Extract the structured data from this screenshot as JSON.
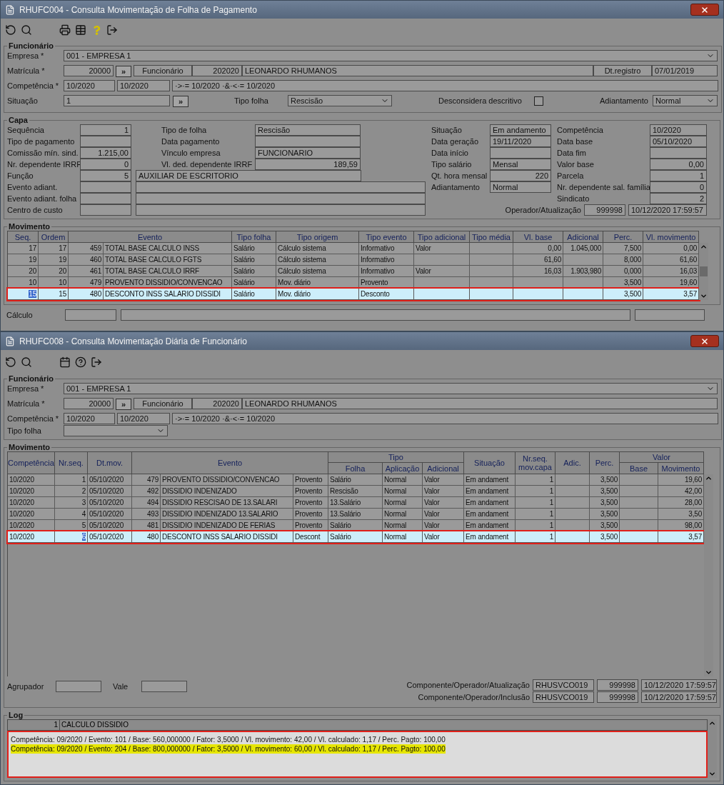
{
  "payroll_window": {
    "title": "RHUFC004 - Consulta Movimentação de Folha de Pagamento",
    "employee": {
      "legend": "Funcionário",
      "empresa": {
        "label": "Empresa *",
        "value": "001 - EMPRESA 1"
      },
      "matricula": {
        "label": "Matrícula *",
        "value": "20000",
        "button": "»"
      },
      "funcionario": {
        "label": "Funcionário",
        "code": "202020",
        "name": "LEONARDO RHUMANOS"
      },
      "registro": {
        "label": "Dt.registro",
        "value": "07/01/2019"
      },
      "competencia": {
        "label": "Competência *",
        "from": "10/2020",
        "to": "10/2020",
        "expression": "·>·= 10/2020 ·&·<·= 10/2020"
      },
      "situacao": {
        "label": "Situação",
        "value": "1",
        "button": "»"
      },
      "tipo_folha": {
        "label": "Tipo folha",
        "value": "Rescisão"
      },
      "desconsidera": {
        "label": "Desconsidera descritivo",
        "checked": false
      },
      "adiantamento": {
        "label": "Adiantamento",
        "value": "Normal"
      }
    },
    "capa": {
      "legend": "Capa",
      "left_rows": [
        [
          {
            "kind": "field",
            "label": "Sequência",
            "value": "1",
            "numeric": true
          },
          {
            "kind": "field",
            "label": "Tipo de folha",
            "value": "Rescisão",
            "numeric": false
          }
        ],
        [
          {
            "kind": "field",
            "label": "Tipo de pagamento"
          },
          {
            "kind": "field",
            "label": "Data pagamento"
          }
        ],
        [
          {
            "kind": "field",
            "label": "Comissão mín. sind.",
            "value": "1.215,00",
            "numeric": true
          },
          {
            "kind": "field",
            "label": "Vínculo empresa",
            "value": "FUNCIONARIO",
            "numeric": false
          }
        ],
        [
          {
            "kind": "field",
            "label": "Nr. dependente IRRF",
            "value": "0",
            "numeric": true
          },
          {
            "kind": "field",
            "label": "Vl. ded. dependente IRRF",
            "value": "189,59",
            "numeric": true
          }
        ],
        [
          {
            "kind": "field",
            "label": "Função",
            "value": "5",
            "numeric": true
          },
          {
            "kind": "box",
            "value": "AUXILIAR DE ESCRITORIO",
            "numeric": false
          }
        ],
        [
          {
            "kind": "field",
            "label": "Evento adiant."
          },
          {
            "kind": "long_box"
          }
        ],
        [
          {
            "kind": "field",
            "label": "Evento adiant. folha"
          },
          {
            "kind": "long_box"
          }
        ],
        [
          {
            "kind": "field",
            "label": "Centro de custo"
          },
          {
            "kind": "long_box"
          }
        ]
      ],
      "right_columns": [
        [
          {
            "label": "Situação",
            "value": "Em andamento",
            "numeric": false
          },
          {
            "label": "Data geração",
            "value": "19/11/2020",
            "numeric": false
          },
          {
            "label": "Data início"
          },
          {
            "label": "Tipo salário",
            "value": "Mensal",
            "numeric": false
          },
          {
            "label": "Qt. hora mensal",
            "value": "220",
            "numeric": true
          },
          {
            "label": "Adiantamento",
            "value": "Normal",
            "numeric": false
          }
        ],
        [
          {
            "label": "Competência",
            "value": "10/2020",
            "numeric": false
          },
          {
            "label": "Data base",
            "value": "05/10/2020",
            "numeric": false
          },
          {
            "label": "Data fim"
          },
          {
            "label": "Valor base",
            "value": "0,00",
            "numeric": true
          },
          {
            "label": "Parcela",
            "value": "1",
            "numeric": true
          },
          {
            "label": "Nr. dependente sal. família",
            "value": "0",
            "numeric": true
          },
          {
            "label": "Sindicato",
            "value": "2",
            "numeric": true
          }
        ]
      ],
      "operator": {
        "label": "Operador/Atualização",
        "code": "999998",
        "timestamp": "10/12/2020 17:59:57"
      }
    },
    "movimento": {
      "legend": "Movimento",
      "columns": [
        {
          "label": "Seq."
        },
        {
          "label": "Ordem"
        },
        {
          "label": "Evento"
        },
        {
          "label": "Tipo folha"
        },
        {
          "label": "Tipo origem"
        },
        {
          "label": "Tipo evento"
        },
        {
          "label": "Tipo adicional"
        },
        {
          "label": "Tipo média"
        },
        {
          "label": "Vl. base"
        },
        {
          "label": "Adicional"
        },
        {
          "label": "Perc."
        },
        {
          "label": "Vl. movimento"
        }
      ],
      "rows": [
        {
          "selected": false,
          "outlined": false,
          "cells": [
            "17",
            "17",
            {
              "code": "459",
              "name": "TOTAL BASE CALCULO INSS"
            },
            "Salário",
            "Cálculo sistema",
            "Informativo",
            "Valor",
            null,
            "0,00",
            "1.045,000",
            "7,500",
            "0,00"
          ]
        },
        {
          "selected": false,
          "outlined": false,
          "cells": [
            "19",
            "19",
            {
              "code": "460",
              "name": "TOTAL BASE CALCULO FGTS"
            },
            "Salário",
            "Cálculo sistema",
            "Informativo",
            null,
            null,
            "61,60",
            null,
            "8,000",
            "61,60"
          ]
        },
        {
          "selected": false,
          "outlined": false,
          "cells": [
            "20",
            "20",
            {
              "code": "461",
              "name": "TOTAL BASE CALCULO IRRF"
            },
            "Salário",
            "Cálculo sistema",
            "Informativo",
            "Valor",
            null,
            "16,03",
            "1.903,980",
            "0,000",
            "16,03"
          ]
        },
        {
          "selected": false,
          "outlined": false,
          "cells": [
            "10",
            "10",
            {
              "code": "479",
              "name": "PROVENTO DISSIDIO/CONVENCAO"
            },
            "Salário",
            "Mov. diário",
            "Provento",
            null,
            null,
            null,
            null,
            "3,500",
            "19,60"
          ]
        },
        {
          "selected": true,
          "outlined": true,
          "cells": [
            "15",
            "15",
            {
              "code": "480",
              "name": "DESCONTO INSS SALARIO DISSIDI"
            },
            "Salário",
            "Mov. diário",
            "Desconto",
            null,
            null,
            null,
            null,
            "3,500",
            "3,57"
          ]
        }
      ]
    },
    "calculo": {
      "label": "Cálculo"
    }
  },
  "daily_window": {
    "title": "RHUFC008 - Consulta Movimentação Diária de Funcionário",
    "employee": {
      "legend": "Funcionário",
      "empresa": {
        "label": "Empresa *",
        "value": "001 - EMPRESA 1"
      },
      "matricula": {
        "label": "Matrícula *",
        "value": "20000",
        "button": "»"
      },
      "funcionario": {
        "label": "Funcionário",
        "code": "202020",
        "name": "LEONARDO RHUMANOS"
      },
      "competencia": {
        "label": "Competência *",
        "from": "10/2020",
        "to": "10/2020",
        "expression": "·>·= 10/2020 ·&·<·= 10/2020"
      },
      "tipo_folha": {
        "label": "Tipo folha"
      }
    },
    "movimento": {
      "legend": "Movimento",
      "columns": [
        {
          "label": "Competência"
        },
        {
          "label": "Nr.seq."
        },
        {
          "label": "Dt.mov."
        },
        {
          "label": "Evento"
        },
        {
          "label": "Tipo",
          "children": [
            {
              "label": "Folha"
            },
            {
              "label": "Aplicação"
            },
            {
              "label": "Adicional"
            }
          ]
        },
        {
          "label": "Situação"
        },
        {
          "label": "Nr.seq. mov.capa"
        },
        {
          "label": "Adic."
        },
        {
          "label": "Perc."
        },
        {
          "label": "Valor",
          "children": [
            {
              "label": "Base"
            },
            {
              "label": "Movimento"
            }
          ]
        }
      ],
      "rows": [
        {
          "selected": false,
          "outlined": false,
          "cells": [
            "10/2020",
            "1",
            "05/10/2020",
            {
              "code": "479",
              "name": "PROVENTO DISSIDIO/CONVENCAO",
              "kind": "Provento"
            },
            {
              "folha": "Salário",
              "aplicacao": "Normal",
              "adicional": "Valor"
            },
            "Em andament",
            "1",
            null,
            "3,500",
            {
              "movimento": "19,60"
            }
          ]
        },
        {
          "selected": false,
          "outlined": false,
          "cells": [
            "10/2020",
            "2",
            "05/10/2020",
            {
              "code": "492",
              "name": "DISSIDIO INDENIZADO",
              "kind": "Provento"
            },
            {
              "folha": "Rescisão",
              "aplicacao": "Normal",
              "adicional": "Valor"
            },
            "Em andament",
            "1",
            null,
            "3,500",
            {
              "movimento": "42,00"
            }
          ]
        },
        {
          "selected": false,
          "outlined": false,
          "cells": [
            "10/2020",
            "3",
            "05/10/2020",
            {
              "code": "494",
              "name": "DISSIDIO RESCISAO DE 13.SALARI",
              "kind": "Provento"
            },
            {
              "folha": "13.Salário",
              "aplicacao": "Normal",
              "adicional": "Valor"
            },
            "Em andament",
            "1",
            null,
            "3,500",
            {
              "movimento": "28,00"
            }
          ]
        },
        {
          "selected": false,
          "outlined": false,
          "cells": [
            "10/2020",
            "4",
            "05/10/2020",
            {
              "code": "493",
              "name": "DISSIDIO INDENIZADO 13.SALARIO",
              "kind": "Provento"
            },
            {
              "folha": "13.Salário",
              "aplicacao": "Normal",
              "adicional": "Valor"
            },
            "Em andament",
            "1",
            null,
            "3,500",
            {
              "movimento": "3,50"
            }
          ]
        },
        {
          "selected": false,
          "outlined": false,
          "cells": [
            "10/2020",
            "5",
            "05/10/2020",
            {
              "code": "481",
              "name": "DISSIDIO INDENIZADO DE FERIAS",
              "kind": "Provento"
            },
            {
              "folha": "Salário",
              "aplicacao": "Normal",
              "adicional": "Valor"
            },
            "Em andament",
            "1",
            null,
            "3,500",
            {
              "movimento": "98,00"
            }
          ]
        },
        {
          "selected": true,
          "outlined": true,
          "cells": [
            "10/2020",
            "6",
            "05/10/2020",
            {
              "code": "480",
              "name": "DESCONTO INSS SALARIO DISSIDI",
              "kind": "Descont"
            },
            {
              "folha": "Salário",
              "aplicacao": "Normal",
              "adicional": "Valor"
            },
            "Em andament",
            "1",
            null,
            "3,500",
            {
              "movimento": "3,57"
            }
          ]
        }
      ]
    },
    "footer": {
      "agrupador": {
        "label": "Agrupador"
      },
      "vale": {
        "label": "Vale"
      },
      "audit": [
        {
          "label": "Componente/Operador/Atualização",
          "component": "RHUSVCO019",
          "operator": "999998",
          "timestamp": "10/12/2020 17:59:57"
        },
        {
          "label": "Componente/Operador/Inclusão",
          "component": "RHUSVCO019",
          "operator": "999998",
          "timestamp": "10/12/2020 17:59:57"
        }
      ]
    },
    "log": {
      "legend": "Log",
      "header": {
        "number": "1",
        "title": "CALCULO DISSIDIO"
      },
      "outlined": true,
      "lines": [
        {
          "text": "Competência: 09/2020 / Evento: 101 / Base: 560,000000 / Fator: 3,5000 / Vl. movimento: 42,00 / Vl. calculado: 1,17 / Perc. Pagto: 100,00",
          "highlighted": false
        },
        {
          "text": "Competência: 09/2020 / Evento: 204 / Base: 800,000000 / Fator: 3,5000 / Vl. movimento: 60,00 / Vl. calculado: 1,17 / Perc. Pagto: 100,00",
          "highlighted": true
        }
      ]
    }
  }
}
